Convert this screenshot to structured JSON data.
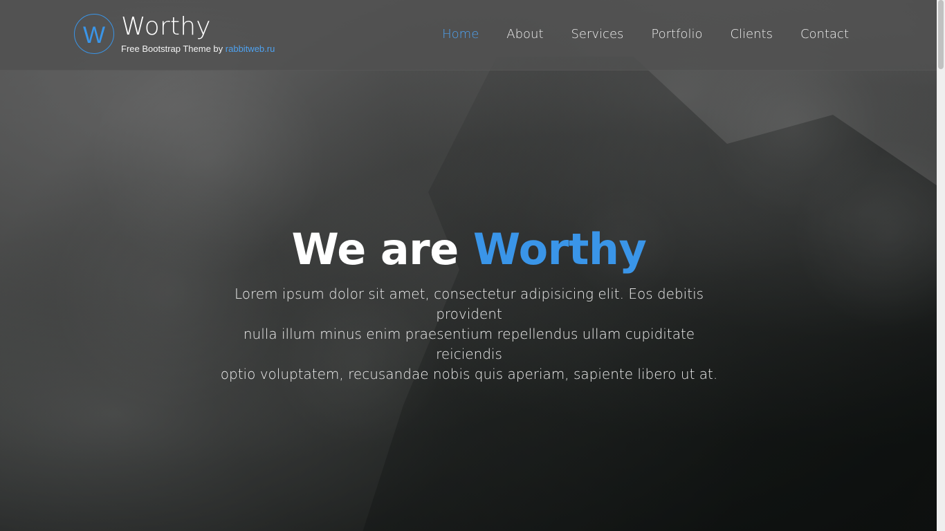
{
  "site": {
    "logo_letter": "W",
    "title": "Worthy",
    "tagline_prefix": "Free Bootstrap Theme by ",
    "tagline_link": "rabbitweb.ru"
  },
  "nav": {
    "items": [
      {
        "label": "Home"
      },
      {
        "label": "About"
      },
      {
        "label": "Services"
      },
      {
        "label": "Portfolio"
      },
      {
        "label": "Clients"
      },
      {
        "label": "Contact"
      }
    ]
  },
  "hero": {
    "title_prefix": "We are ",
    "title_accent": "Worthy",
    "description_line_1": "Lorem ipsum dolor sit amet, consectetur adipisicing elit. Eos debitis provident",
    "description_line_2": "nulla illum minus enim praesentium repellendus ullam cupiditate reiciendis",
    "description_line_3": "optio voluptatem, recusandae nobis quis aperiam, sapiente libero ut at."
  },
  "theme": {
    "accent_color": "#3a95e8",
    "header_bg": "#505050"
  }
}
